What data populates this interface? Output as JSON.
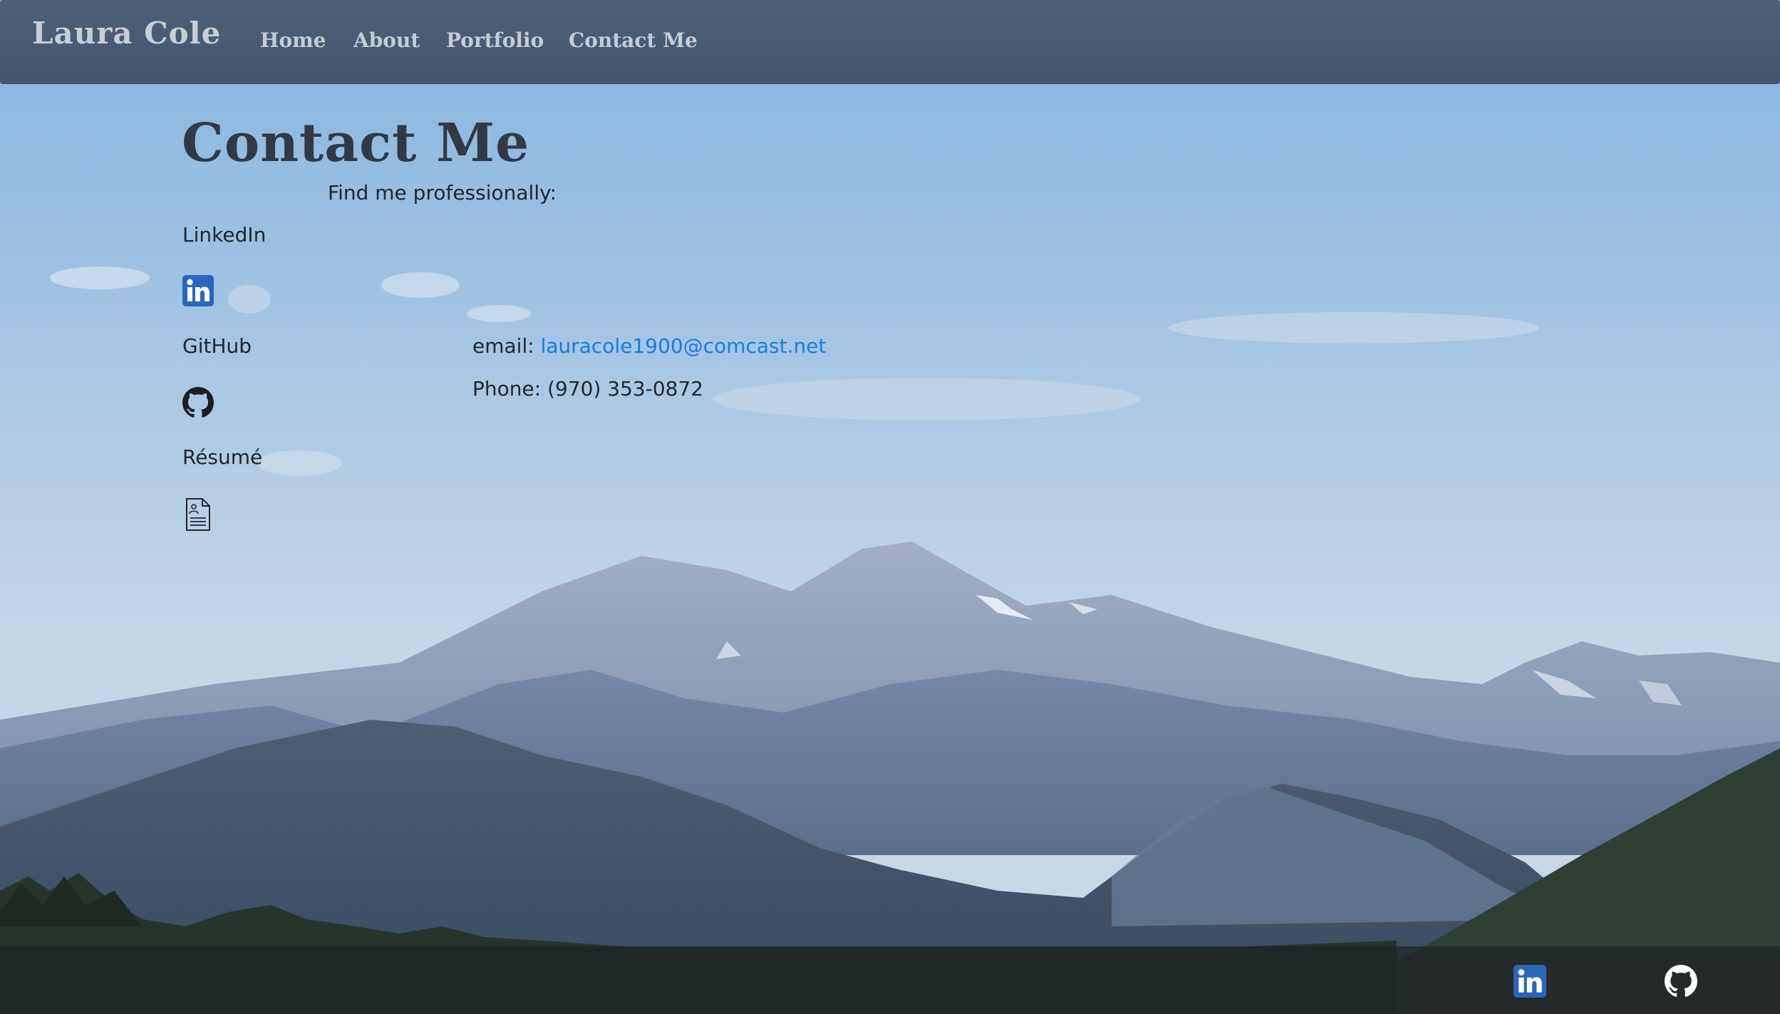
{
  "navbar": {
    "brand": "Laura Cole",
    "links": [
      "Home",
      "About",
      "Portfolio",
      "Contact Me"
    ]
  },
  "main": {
    "title": "Contact Me",
    "find_me": "Find me professionally:",
    "profiles": [
      {
        "label": "LinkedIn",
        "icon": "linkedin-icon"
      },
      {
        "label": "GitHub",
        "icon": "github-icon"
      },
      {
        "label": "Résumé",
        "icon": "document-icon"
      }
    ],
    "email_label": "email:",
    "email": "lauracole1900@comcast.net",
    "phone_label": "Phone:",
    "phone": "(970) 353-0872"
  },
  "footer": {
    "icons": [
      "linkedin-icon",
      "github-icon"
    ]
  },
  "colors": {
    "navbar": "#4a5d76",
    "link": "#1a7be0",
    "linkedin": "#2a66bc",
    "footer": "#1e2226"
  }
}
